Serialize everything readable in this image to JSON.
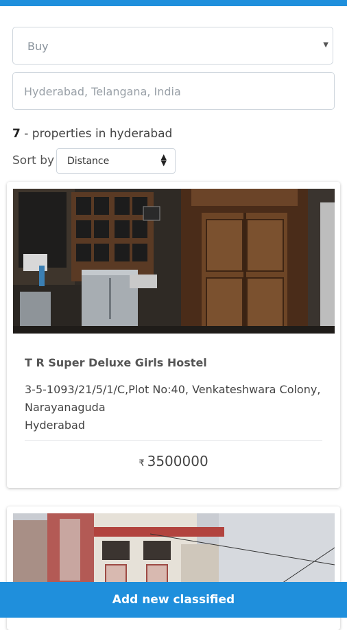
{
  "search": {
    "type_value": "Buy",
    "location_placeholder": "Hyderabad, Telangana, India"
  },
  "results": {
    "count": "7",
    "count_text": " - properties in hyderabad"
  },
  "sort": {
    "label": "Sort by",
    "value": "Distance"
  },
  "listings": [
    {
      "title": "T R Super Deluxe Girls Hostel",
      "address_line1": "3-5-1093/21/5/1/C,Plot No:40, Venkateshwara Colony,",
      "address_line2": "Narayanaguda",
      "city": "Hyderabad",
      "currency": "₹",
      "price": "3500000"
    }
  ],
  "bottom": {
    "add_label": "Add new classified"
  },
  "colors": {
    "accent": "#1f8fdc"
  }
}
